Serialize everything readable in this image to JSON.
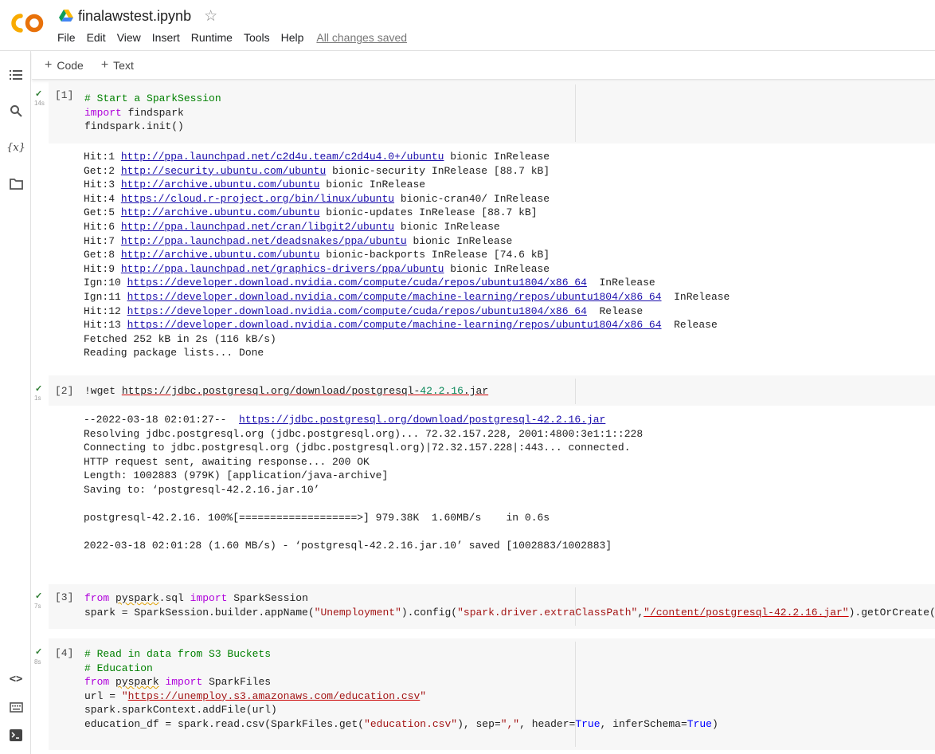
{
  "header": {
    "title": "finalawstest.ipynb",
    "menu": [
      "File",
      "Edit",
      "View",
      "Insert",
      "Runtime",
      "Tools",
      "Help"
    ],
    "saved_status": "All changes saved"
  },
  "toolbar": {
    "code_label": "Code",
    "text_label": "Text"
  },
  "sidebar": {
    "icons": [
      "table-of-contents-icon",
      "search-icon",
      "variables-icon",
      "files-icon",
      "code-snippets-icon",
      "command-palette-icon",
      "terminal-icon"
    ]
  },
  "colors": {
    "logo_orange": "#F9AB00",
    "logo_dark_orange": "#E8710A",
    "check_green": "#2E7D32",
    "keyword": "#AF00DB",
    "comment": "#008000",
    "string": "#A31515",
    "link": "#1A0DAB"
  },
  "cells": [
    {
      "count": "[1]",
      "time": "14s",
      "code": [
        "# Start a SparkSession",
        "import findspark",
        "findspark.init()"
      ],
      "output": [
        {
          "pre": "Hit:1 ",
          "link": "http://ppa.launchpad.net/c2d4u.team/c2d4u4.0+/ubuntu",
          "post": " bionic InRelease"
        },
        {
          "pre": "Get:2 ",
          "link": "http://security.ubuntu.com/ubuntu",
          "post": " bionic-security InRelease [88.7 kB]"
        },
        {
          "pre": "Hit:3 ",
          "link": "http://archive.ubuntu.com/ubuntu",
          "post": " bionic InRelease"
        },
        {
          "pre": "Hit:4 ",
          "link": "https://cloud.r-project.org/bin/linux/ubuntu",
          "post": " bionic-cran40/ InRelease"
        },
        {
          "pre": "Get:5 ",
          "link": "http://archive.ubuntu.com/ubuntu",
          "post": " bionic-updates InRelease [88.7 kB]"
        },
        {
          "pre": "Hit:6 ",
          "link": "http://ppa.launchpad.net/cran/libgit2/ubuntu",
          "post": " bionic InRelease"
        },
        {
          "pre": "Hit:7 ",
          "link": "http://ppa.launchpad.net/deadsnakes/ppa/ubuntu",
          "post": " bionic InRelease"
        },
        {
          "pre": "Get:8 ",
          "link": "http://archive.ubuntu.com/ubuntu",
          "post": " bionic-backports InRelease [74.6 kB]"
        },
        {
          "pre": "Hit:9 ",
          "link": "http://ppa.launchpad.net/graphics-drivers/ppa/ubuntu",
          "post": " bionic InRelease"
        },
        {
          "pre": "Ign:10 ",
          "link": "https://developer.download.nvidia.com/compute/cuda/repos/ubuntu1804/x86_64",
          "post": "  InRelease"
        },
        {
          "pre": "Ign:11 ",
          "link": "https://developer.download.nvidia.com/compute/machine-learning/repos/ubuntu1804/x86_64",
          "post": "  InRelease"
        },
        {
          "pre": "Hit:12 ",
          "link": "https://developer.download.nvidia.com/compute/cuda/repos/ubuntu1804/x86_64",
          "post": "  Release"
        },
        {
          "pre": "Hit:13 ",
          "link": "https://developer.download.nvidia.com/compute/machine-learning/repos/ubuntu1804/x86_64",
          "post": "  Release"
        },
        {
          "pre": "Fetched 252 kB in 2s (116 kB/s)",
          "link": "",
          "post": ""
        },
        {
          "pre": "Reading package lists... Done",
          "link": "",
          "post": ""
        }
      ]
    },
    {
      "count": "[2]",
      "time": "1s",
      "code": [
        "!wget https://jdbc.postgresql.org/download/postgresql-42.2.16.jar"
      ],
      "output": [
        {
          "pre": "--2022-03-18 02:01:27--  ",
          "link": "https://jdbc.postgresql.org/download/postgresql-42.2.16.jar",
          "post": ""
        },
        {
          "pre": "Resolving jdbc.postgresql.org (jdbc.postgresql.org)... 72.32.157.228, 2001:4800:3e1:1::228",
          "link": "",
          "post": ""
        },
        {
          "pre": "Connecting to jdbc.postgresql.org (jdbc.postgresql.org)|72.32.157.228|:443... connected.",
          "link": "",
          "post": ""
        },
        {
          "pre": "HTTP request sent, awaiting response... 200 OK",
          "link": "",
          "post": ""
        },
        {
          "pre": "Length: 1002883 (979K) [application/java-archive]",
          "link": "",
          "post": ""
        },
        {
          "pre": "Saving to: ‘postgresql-42.2.16.jar.10’",
          "link": "",
          "post": ""
        },
        {
          "pre": "",
          "link": "",
          "post": ""
        },
        {
          "pre": "postgresql-42.2.16. 100%[===================>] 979.38K  1.60MB/s    in 0.6s",
          "link": "",
          "post": ""
        },
        {
          "pre": "",
          "link": "",
          "post": ""
        },
        {
          "pre": "2022-03-18 02:01:28 (1.60 MB/s) - ‘postgresql-42.2.16.jar.10’ saved [1002883/1002883]",
          "link": "",
          "post": ""
        }
      ]
    },
    {
      "count": "[3]",
      "time": "7s",
      "code": [
        "from pyspark.sql import SparkSession",
        "spark = SparkSession.builder.appName(\"Unemployment\").config(\"spark.driver.extraClassPath\",\"/content/postgresql-42.2.16.jar\").getOrCreate()"
      ]
    },
    {
      "count": "[4]",
      "time": "8s",
      "code": [
        "# Read in data from S3 Buckets",
        "# Education",
        "from pyspark import SparkFiles",
        "url = \"https://unemploy.s3.amazonaws.com/education.csv\"",
        "spark.sparkContext.addFile(url)",
        "education_df = spark.read.csv(SparkFiles.get(\"education.csv\"), sep=\",\", header=True, inferSchema=True)"
      ]
    }
  ]
}
